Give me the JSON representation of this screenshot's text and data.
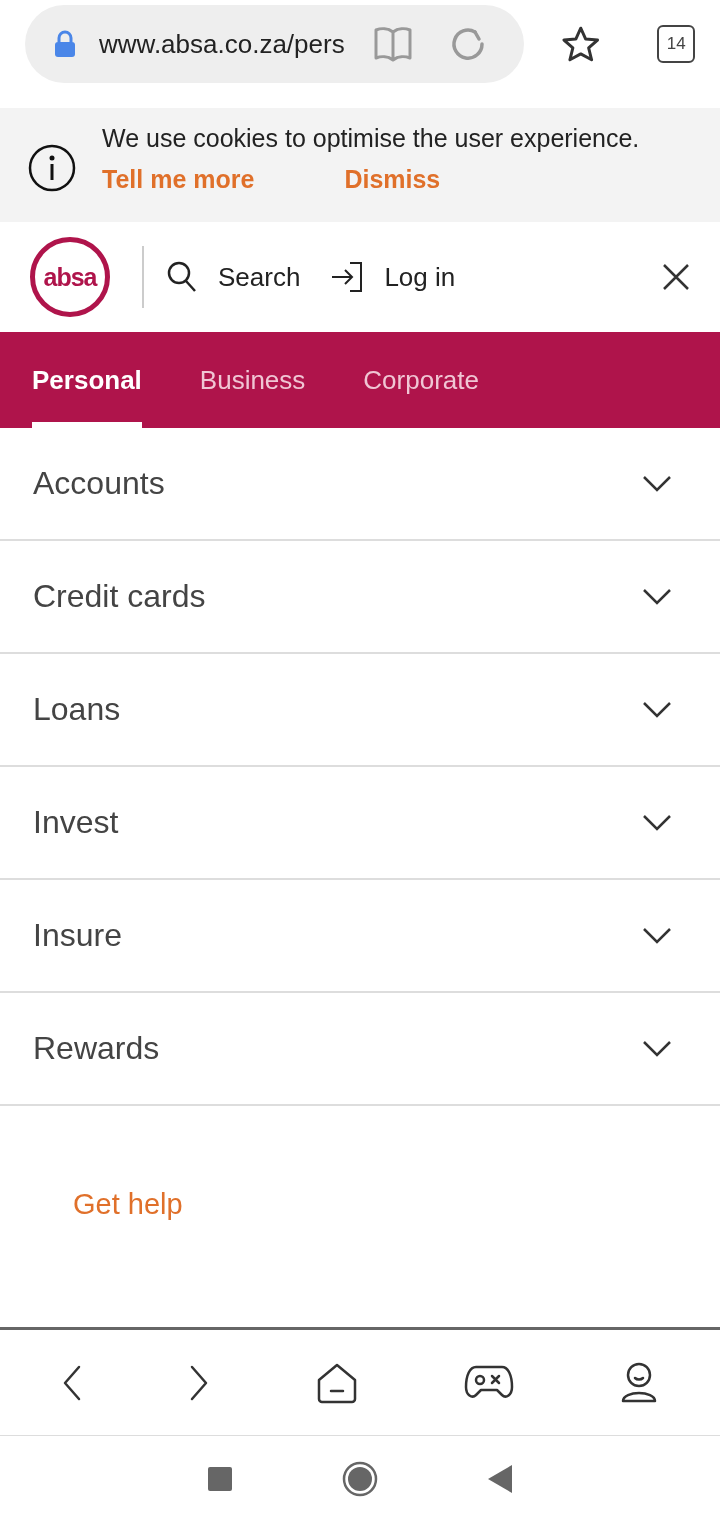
{
  "browser": {
    "url": "www.absa.co.za/pers",
    "tab_count": "14"
  },
  "cookie_banner": {
    "message": "We use cookies to optimise the user experience.",
    "links": [
      "Tell me more",
      "Dismiss"
    ]
  },
  "header": {
    "logo_text": "absa",
    "search": "Search",
    "login": "Log in"
  },
  "tabs": [
    {
      "label": "Personal",
      "selected": true
    },
    {
      "label": "Business",
      "selected": false
    },
    {
      "label": "Corporate",
      "selected": false
    }
  ],
  "menu": [
    {
      "label": "Accounts",
      "expanded": false
    },
    {
      "label": "Credit cards",
      "expanded": false
    },
    {
      "label": "Loans",
      "expanded": false
    },
    {
      "label": "Invest",
      "expanded": false
    },
    {
      "label": "Insure",
      "expanded": false
    },
    {
      "label": "Rewards",
      "expanded": false
    }
  ],
  "help_link": "Get help"
}
